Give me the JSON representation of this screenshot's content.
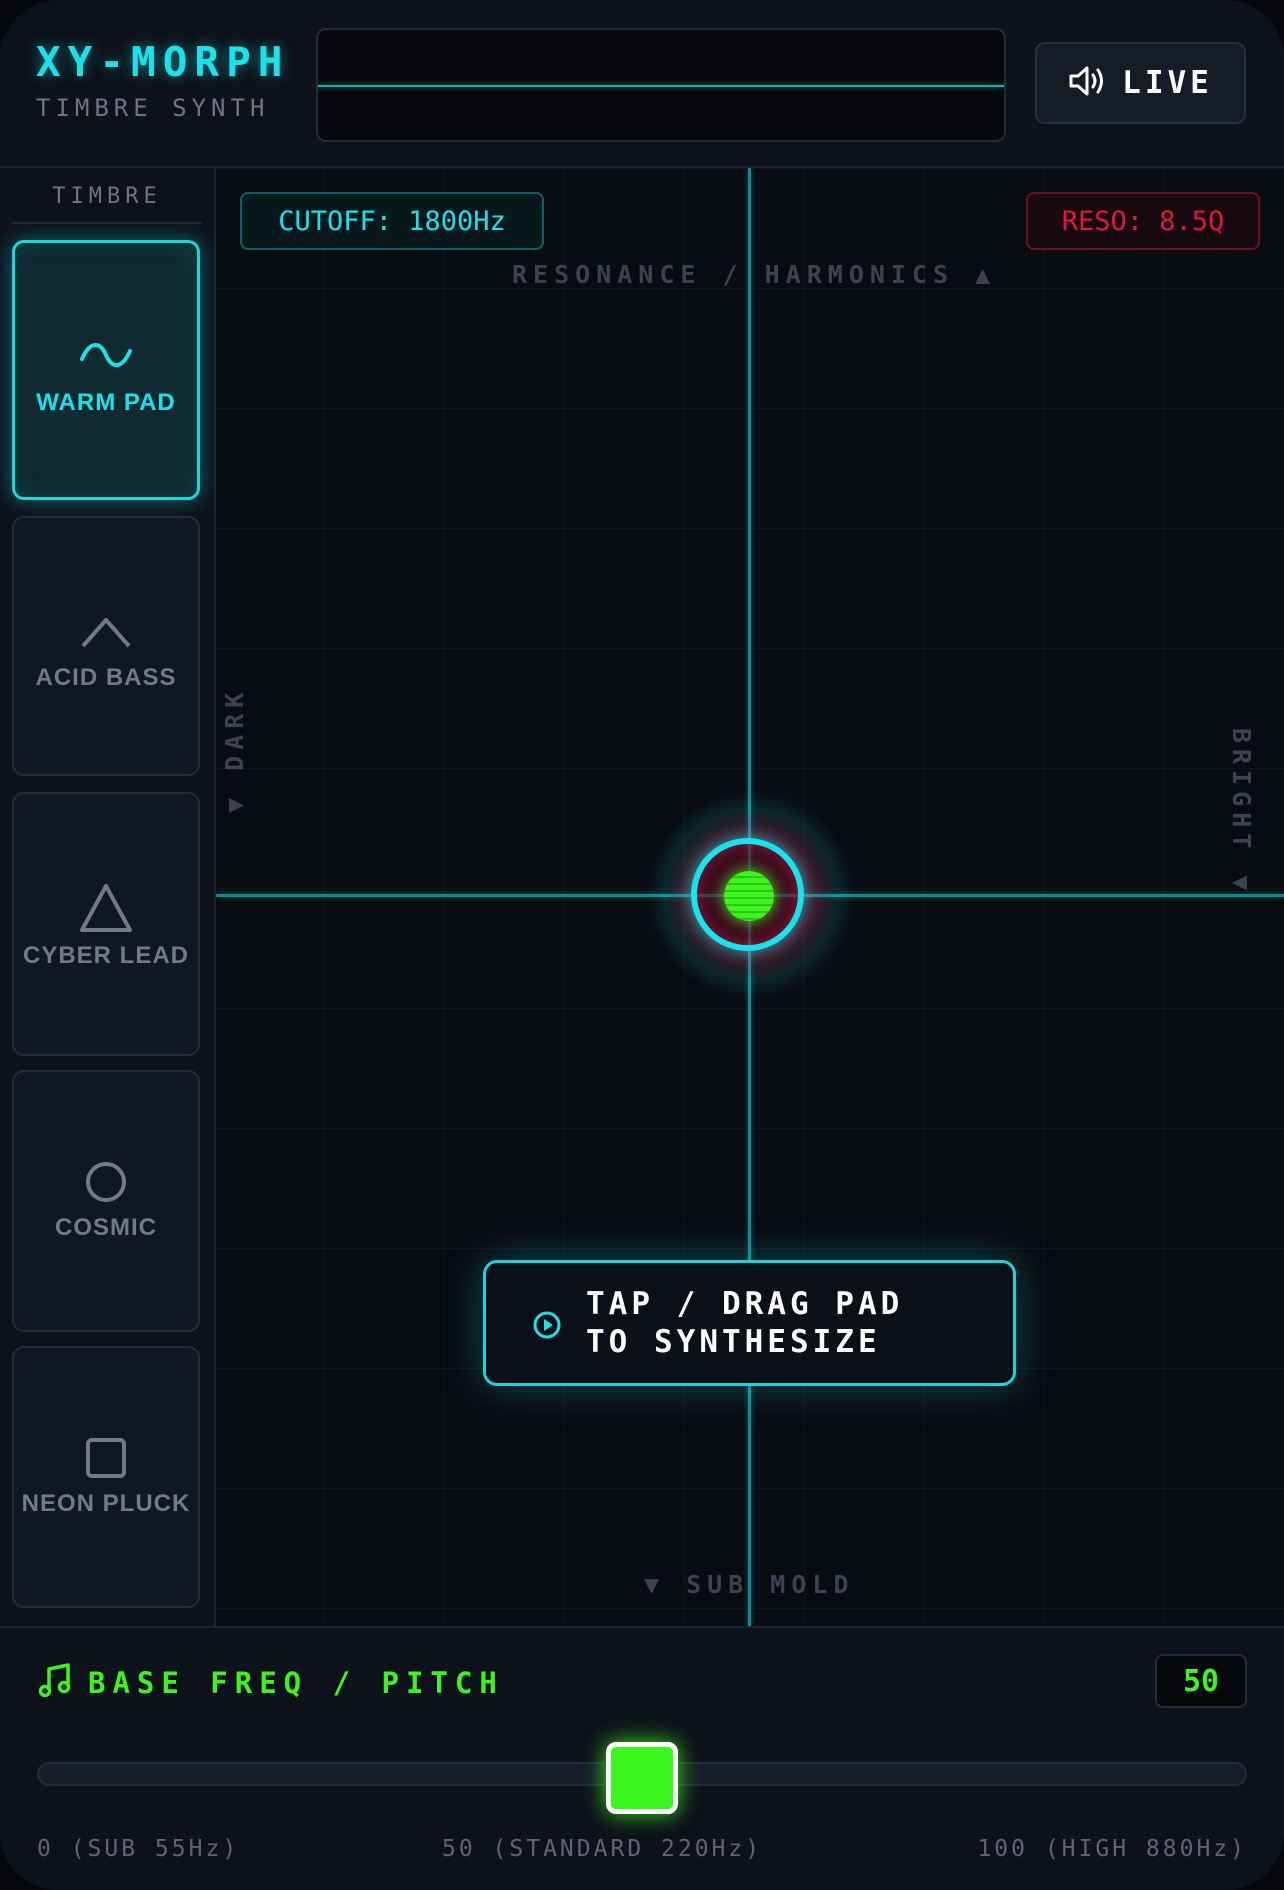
{
  "header": {
    "title": "XY-MORPH",
    "subtitle": "TIMBRE SYNTH",
    "live_label": "LIVE",
    "live_icon": "speaker-volume-icon"
  },
  "sidebar": {
    "heading": "TIMBRE",
    "presets": [
      {
        "label": "WARM PAD",
        "icon": "sine-wave-icon",
        "active": true
      },
      {
        "label": "ACID BASS",
        "icon": "chevron-up-icon",
        "active": false
      },
      {
        "label": "CYBER LEAD",
        "icon": "triangle-icon",
        "active": false
      },
      {
        "label": "COSMIC",
        "icon": "circle-icon",
        "active": false
      },
      {
        "label": "NEON PLUCK",
        "icon": "square-icon",
        "active": false
      }
    ]
  },
  "pad": {
    "cutoff_label": "CUTOFF: 1800Hz",
    "reso_label": "RESO: 8.5Q",
    "axis_top": "RESONANCE / HARMONICS ▲",
    "axis_bottom": "▼ SUB MOLD",
    "axis_left": "▼ DARK",
    "axis_right": "BRIGHT ▼",
    "hint_text": "TAP / DRAG PAD\nTO SYNTHESIZE",
    "hint_icon": "play-circle-icon"
  },
  "pitch": {
    "label": "BASE FREQ / PITCH",
    "icon": "music-note-icon",
    "value": "50",
    "slider_value": 50,
    "slider_min": 0,
    "slider_max": 100,
    "tick_min": "0 (SUB 55Hz)",
    "tick_mid": "50 (STANDARD 220Hz)",
    "tick_max": "100 (HIGH 880Hz)"
  },
  "colors": {
    "accent_cyan": "#19e3ea",
    "accent_green": "#3cf51d",
    "accent_red": "#e0163f"
  }
}
